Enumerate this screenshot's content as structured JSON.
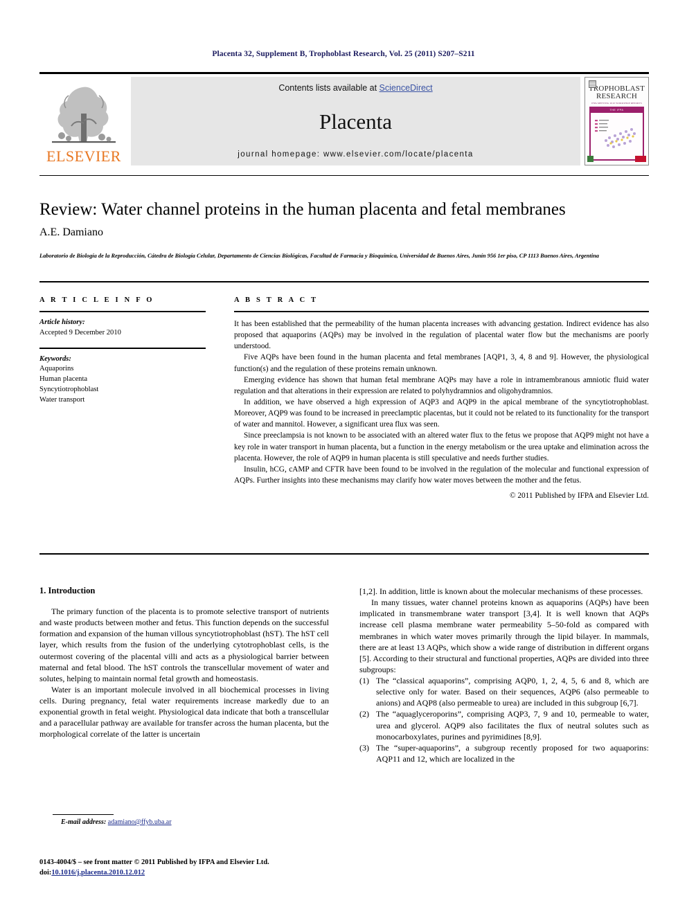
{
  "running_head": "Placenta 32, Supplement B, Trophoblast Research, Vol. 25 (2011) S207–S211",
  "masthead": {
    "publisher_name": "ELSEVIER",
    "contents_prefix": "Contents lists available at ",
    "sciencedirect": "ScienceDirect",
    "journal_title": "Placenta",
    "homepage": "journal homepage: www.elsevier.com/locate/placenta",
    "cover": {
      "line1": "TROPHOBLAST",
      "line2": "RESEARCH",
      "subtitle": "IFPA MEETING 2010 WORKSHOP REPORTS",
      "figure_caption": "THE IFPA"
    }
  },
  "article": {
    "title": "Review: Water channel proteins in the human placenta and fetal membranes",
    "authors": "A.E. Damiano",
    "affiliation": "Laboratorio de Biología de la Reproducción, Cátedra de Biología Celular, Departamento de Ciencias Biológicas, Facultad de Farmacia y Bioquímica, Universidad de Buenos Aires, Junín 956 1er piso, CP 1113 Buenos Aires, Argentina"
  },
  "article_info": {
    "heading": "A R T I C L E  I N F O",
    "history_label": "Article history:",
    "history_value": "Accepted 9 December 2010",
    "keywords_label": "Keywords:",
    "keywords": [
      "Aquaporins",
      "Human placenta",
      "Syncytiotrophoblast",
      "Water transport"
    ]
  },
  "abstract": {
    "heading": "A B S T R A C T",
    "paragraphs": [
      "It has been established that the permeability of the human placenta increases with advancing gestation. Indirect evidence has also proposed that aquaporins (AQPs) may be involved in the regulation of placental water flow but the mechanisms are poorly understood.",
      "Five AQPs have been found in the human placenta and fetal membranes [AQP1, 3, 4, 8 and 9]. However, the physiological function(s) and the regulation of these proteins remain unknown.",
      "Emerging evidence has shown that human fetal membrane AQPs may have a role in intramembranous amniotic fluid water regulation and that alterations in their expression are related to polyhydramnios and oligohydramnios.",
      "In addition, we have observed a high expression of AQP3 and AQP9 in the apical membrane of the syncytiotrophoblast. Moreover, AQP9 was found to be increased in preeclamptic placentas, but it could not be related to its functionality for the transport of water and mannitol. However, a significant urea flux was seen.",
      "Since preeclampsia is not known to be associated with an altered water flux to the fetus we propose that AQP9 might not have a key role in water transport in human placenta, but a function in the energy metabolism or the urea uptake and elimination across the placenta. However, the role of AQP9 in human placenta is still speculative and needs further studies.",
      "Insulin, hCG, cAMP and CFTR have been found to be involved in the regulation of the molecular and functional expression of AQPs. Further insights into these mechanisms may clarify how water moves between the mother and the fetus."
    ],
    "copyright": "© 2011 Published by IFPA and Elsevier Ltd."
  },
  "introduction": {
    "heading": "1. Introduction",
    "left_paragraphs": [
      "The primary function of the placenta is to promote selective transport of nutrients and waste products between mother and fetus. This function depends on the successful formation and expansion of the human villous syncytiotrophoblast (hST). The hST cell layer, which results from the fusion of the underlying cytotrophoblast cells, is the outermost covering of the placental villi and acts as a physiological barrier between maternal and fetal blood. The hST controls the transcellular movement of water and solutes, helping to maintain normal fetal growth and homeostasis.",
      "Water is an important molecule involved in all biochemical processes in living cells. During pregnancy, fetal water requirements increase markedly due to an exponential growth in fetal weight. Physiological data indicate that both a transcellular and a paracellular pathway are available for transfer across the human placenta, but the morphological correlate of the latter is uncertain"
    ],
    "right_continuation": "[1,2]. In addition, little is known about the molecular mechanisms of these processes.",
    "right_paragraph": "In many tissues, water channel proteins known as aquaporins (AQPs) have been implicated in transmembrane water transport [3,4]. It is well known that AQPs increase cell plasma membrane water permeability 5–50-fold as compared with membranes in which water moves primarily through the lipid bilayer. In mammals, there are at least 13 AQPs, which show a wide range of distribution in different organs [5]. According to their structural and functional properties, AQPs are divided into three subgroups:",
    "subgroups": [
      {
        "marker": "(1)",
        "text": "The “classical aquaporins”, comprising AQP0, 1, 2, 4, 5, 6 and 8, which are selective only for water. Based on their sequences, AQP6 (also permeable to anions) and AQP8 (also permeable to urea) are included in this subgroup [6,7]."
      },
      {
        "marker": "(2)",
        "text": "The “aquaglyceroporins”, comprising AQP3, 7, 9 and 10, permeable to water, urea and glycerol. AQP9 also facilitates the flux of neutral solutes such as monocarboxylates, purines and pyrimidines [8,9]."
      },
      {
        "marker": "(3)",
        "text": "The “super-aquaporins”, a subgroup recently proposed for two aquaporins: AQP11 and 12, which are localized in the"
      }
    ]
  },
  "footnote": {
    "label": "E-mail address:",
    "email": "adamiano@ffyb.uba.ar"
  },
  "footer": {
    "line1": "0143-4004/$ – see front matter © 2011 Published by IFPA and Elsevier Ltd.",
    "doi_label": "doi:",
    "doi_value": "10.1016/j.placenta.2010.12.012"
  },
  "colors": {
    "running_head": "#1a1a5e",
    "link": "#3a53a4",
    "elsevier_orange": "#E87722",
    "reference": "#1a2a8a",
    "banner_bg": "#e6e6e6"
  }
}
